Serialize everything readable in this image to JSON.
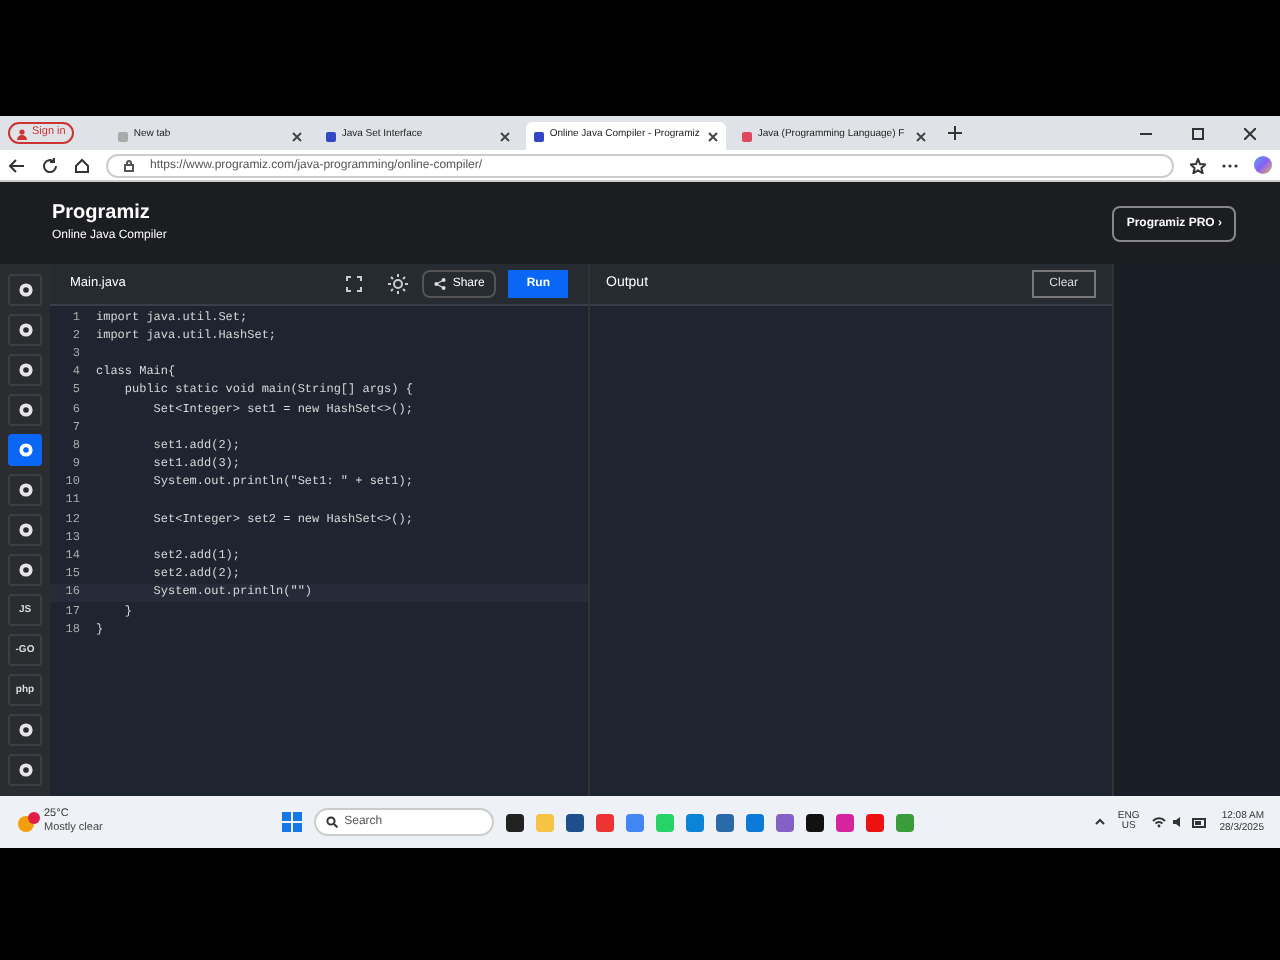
{
  "browser": {
    "profile": "Sign in",
    "tabs": [
      {
        "title": "New tab",
        "selected": false
      },
      {
        "title": "Java Set Interface",
        "selected": false
      },
      {
        "title": "Online Java Compiler - Programiz",
        "selected": true
      },
      {
        "title": "Java (Programming Language) F",
        "selected": false
      }
    ],
    "url": "https://www.programiz.com/java-programming/online-compiler/"
  },
  "site": {
    "logo": "Programiz",
    "subtitle": "Online Java Compiler",
    "pro_button": "Programiz PRO ›"
  },
  "languages": [
    {
      "selected": false
    },
    {
      "selected": false
    },
    {
      "selected": false
    },
    {
      "selected": false
    },
    {
      "selected": true
    },
    {
      "selected": false
    },
    {
      "selected": false
    },
    {
      "selected": false
    },
    {
      "label": "JS",
      "selected": false
    },
    {
      "label": "-GO",
      "selected": false
    },
    {
      "label": "php",
      "selected": false
    },
    {
      "selected": false
    },
    {
      "selected": false
    }
  ],
  "editor": {
    "file_tab": "Main.java",
    "share": "Share",
    "run": "Run",
    "lines": [
      {
        "number": "1",
        "code": "import java.util.Set;"
      },
      {
        "number": "2",
        "code": "import java.util.HashSet;"
      },
      {
        "number": "3"
      },
      {
        "number": "4",
        "code": "class Main{"
      },
      {
        "number": "5",
        "code": "    public static void main(String[] args) {"
      },
      {
        "number": "6",
        "code": "        Set<Integer> set1 = new HashSet<>();"
      },
      {
        "number": "7"
      },
      {
        "number": "8",
        "code": "        set1.add(2);"
      },
      {
        "number": "9",
        "code": "        set1.add(3);"
      },
      {
        "number": "10",
        "code": "        System.out.println(\"Set1: \" + set1);"
      },
      {
        "number": "11"
      },
      {
        "number": "12",
        "code": "        Set<Integer> set2 = new HashSet<>();"
      },
      {
        "number": "13"
      },
      {
        "number": "14",
        "code": "        set2.add(1);"
      },
      {
        "number": "15",
        "code": "        set2.add(2);"
      },
      {
        "number": "16",
        "code": "        System.out.println(\"\")",
        "selected": true
      },
      {
        "number": "17",
        "code": "    }"
      },
      {
        "number": "18",
        "code": "}"
      }
    ]
  },
  "output": {
    "title": "Output",
    "clear": "Clear"
  },
  "taskbar": {
    "temperature": "25°C",
    "weather": "Mostly clear",
    "search": "Search",
    "language": "ENG",
    "region": "US",
    "time": "12:08 AM",
    "date": "28/3/2025"
  }
}
